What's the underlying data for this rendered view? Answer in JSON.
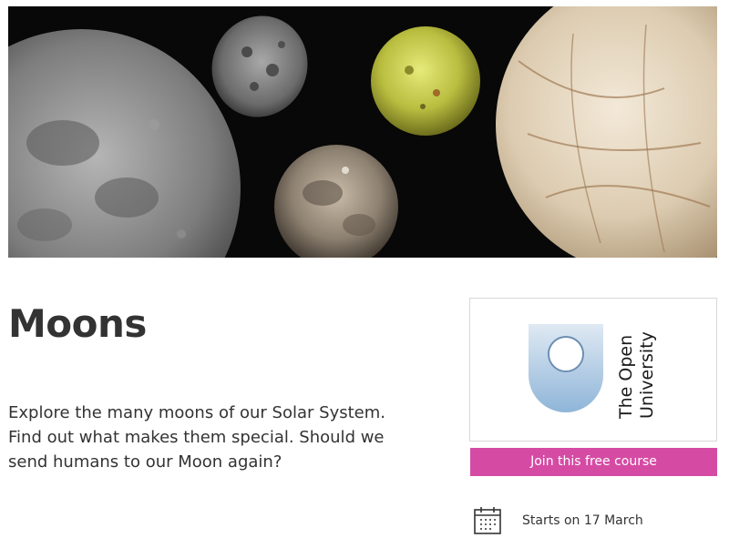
{
  "course": {
    "title": "Moons",
    "description_lines": [
      "Explore the many moons of our Solar System.",
      "Find out what makes them special. Should we",
      "send humans to our Moon again?"
    ]
  },
  "provider": {
    "logo_line1": "The Open",
    "logo_line2": "University"
  },
  "actions": {
    "join_label": "Join this free course"
  },
  "schedule": {
    "start_text": "Starts on 17 March"
  },
  "colors": {
    "accent": "#d54ba4",
    "text": "#333333",
    "logo_blue": "#8fb5d8"
  },
  "icons": {
    "calendar": "calendar-icon",
    "logo": "open-university-logo"
  }
}
